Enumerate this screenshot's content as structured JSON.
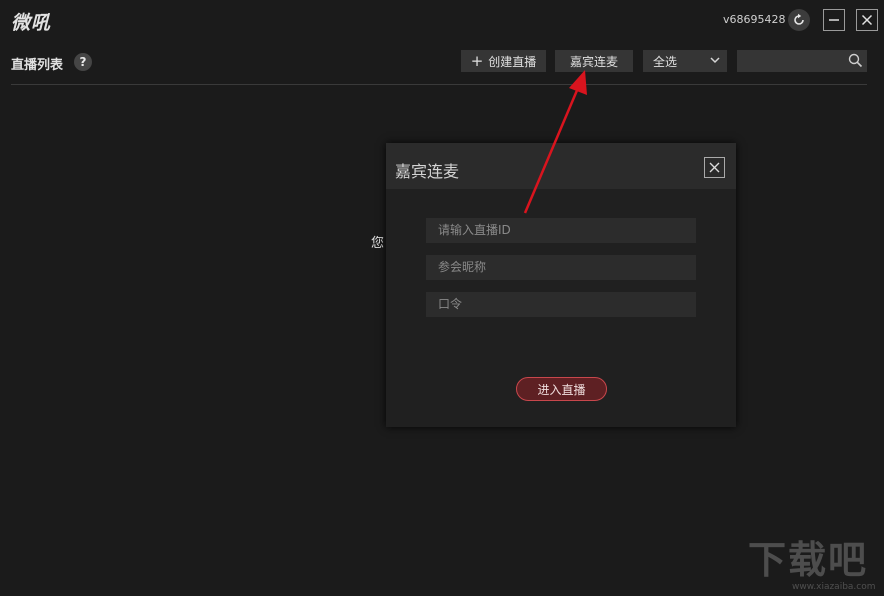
{
  "app": {
    "logo": "微吼",
    "user_id": "v68695428"
  },
  "toolbar": {
    "list_title": "直播列表",
    "help_label": "?",
    "create_label": "创建直播",
    "guest_label": "嘉宾连麦",
    "select_value": "全选",
    "search_value": ""
  },
  "main": {
    "partial_text": "您"
  },
  "dialog": {
    "title": "嘉宾连麦",
    "live_id_placeholder": "请输入直播ID",
    "nickname_placeholder": "参会昵称",
    "password_placeholder": "口令",
    "enter_label": "进入直播"
  },
  "watermark": {
    "brand": "下载吧",
    "url": "www.xiazaiba.com"
  },
  "colors": {
    "background": "#1b1b1b",
    "button_bg": "#353535",
    "dialog_bg": "#202020",
    "dialog_header_bg": "#2b2b2b",
    "accent_button_bg": "#5e2023",
    "accent_button_border": "#c8474c",
    "annotation_arrow": "#d9141e"
  },
  "icons": [
    "refresh-icon",
    "minimize-icon",
    "close-icon",
    "help-icon",
    "plus-icon",
    "chevron-down-icon",
    "search-icon",
    "dialog-close-icon",
    "annotation-arrow"
  ]
}
